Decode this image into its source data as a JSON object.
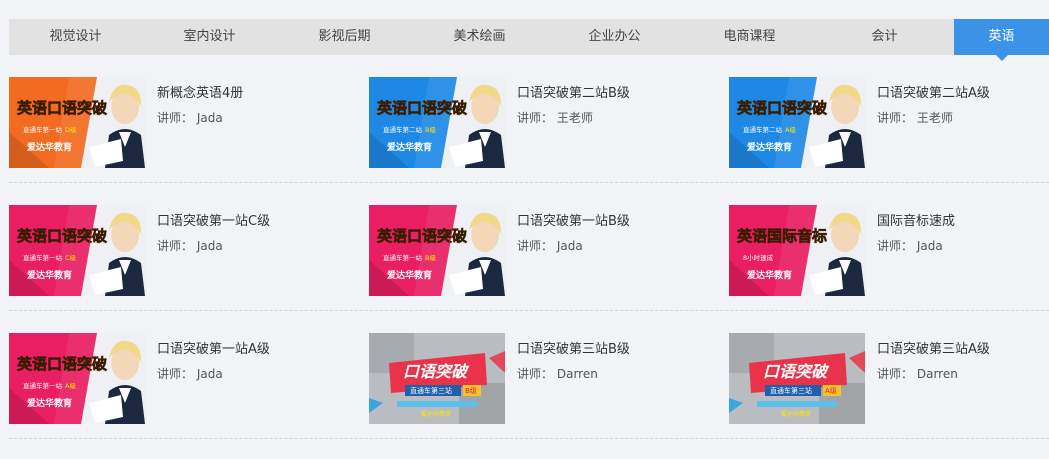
{
  "tabs": [
    {
      "label": "视觉设计",
      "active": false
    },
    {
      "label": "室内设计",
      "active": false
    },
    {
      "label": "影视后期",
      "active": false
    },
    {
      "label": "美术绘画",
      "active": false
    },
    {
      "label": "企业办公",
      "active": false
    },
    {
      "label": "电商课程",
      "active": false
    },
    {
      "label": "会计",
      "active": false
    },
    {
      "label": "英语",
      "active": true
    }
  ],
  "teacher_prefix": "讲师：",
  "courses": [
    {
      "title": "新概念英语4册",
      "teacher": "Jada",
      "thumb": {
        "style": "portrait",
        "bg": "#f26b21",
        "headline": "英语口语突破",
        "sub": "直通车第一站",
        "level": "D级",
        "brand": "爱达华教育"
      }
    },
    {
      "title": "口语突破第二站B级",
      "teacher": "王老师",
      "thumb": {
        "style": "portrait",
        "bg": "#1e88e5",
        "headline": "英语口语突破",
        "sub": "直通车第二站",
        "level": "B级",
        "brand": "爱达华教育"
      }
    },
    {
      "title": "口语突破第二站A级",
      "teacher": "王老师",
      "thumb": {
        "style": "portrait",
        "bg": "#1e88e5",
        "headline": "英语口语突破",
        "sub": "直通车第二站",
        "level": "A级",
        "brand": "爱达华教育"
      }
    },
    {
      "title": "口语突破第一站C级",
      "teacher": "Jada",
      "thumb": {
        "style": "portrait",
        "bg": "#e91e63",
        "headline": "英语口语突破",
        "sub": "直通车第一站",
        "level": "C级",
        "brand": "爱达华教育"
      }
    },
    {
      "title": "口语突破第一站B级",
      "teacher": "Jada",
      "thumb": {
        "style": "portrait",
        "bg": "#e91e63",
        "headline": "英语口语突破",
        "sub": "直通车第一站",
        "level": "B级",
        "brand": "爱达华教育"
      }
    },
    {
      "title": "国际音标速成",
      "teacher": "Jada",
      "thumb": {
        "style": "portrait",
        "bg": "#e91e63",
        "headline": "英语国际音标",
        "sub": "8小时速成",
        "level": "",
        "brand": "爱达华教育"
      }
    },
    {
      "title": "口语突破第一站A级",
      "teacher": "Jada",
      "thumb": {
        "style": "portrait",
        "bg": "#e91e63",
        "headline": "英语口语突破",
        "sub": "直通车第一站",
        "level": "A级",
        "brand": "爱达华教育"
      }
    },
    {
      "title": "口语突破第三站B级",
      "teacher": "Darren",
      "thumb": {
        "style": "banner",
        "bg": "#b9bcc0",
        "headline": "口语突破",
        "sub": "直通车第三站",
        "level": "B级",
        "brand": "爱达华教育"
      }
    },
    {
      "title": "口语突破第三站A级",
      "teacher": "Darren",
      "thumb": {
        "style": "banner",
        "bg": "#b9bcc0",
        "headline": "口语突破",
        "sub": "直通车第三站",
        "level": "A级",
        "brand": "爱达华教育"
      }
    }
  ]
}
